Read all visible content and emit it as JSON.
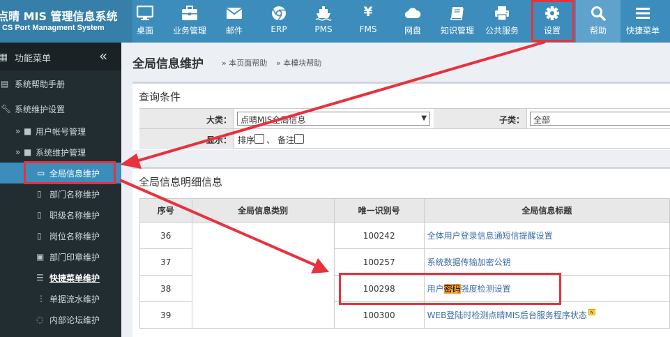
{
  "app": {
    "title": "点晴 MIS 管理信息系统",
    "subtitle": "CS Port Managment System"
  },
  "nav": [
    {
      "label": "桌面",
      "icon": "monitor-icon"
    },
    {
      "label": "业务管理",
      "icon": "briefcase-icon"
    },
    {
      "label": "邮件",
      "icon": "envelope-icon"
    },
    {
      "label": "ERP",
      "icon": "chrome-icon"
    },
    {
      "label": "PMS",
      "icon": "ship-icon"
    },
    {
      "label": "FMS",
      "icon": "yen-icon",
      "glyph": "¥"
    },
    {
      "label": "网盘",
      "icon": "cloud-icon"
    },
    {
      "label": "知识管理",
      "icon": "book-icon"
    },
    {
      "label": "公共服务",
      "icon": "printer-icon"
    },
    {
      "label": "设置",
      "icon": "gear-icon"
    },
    {
      "label": "帮助",
      "icon": "search-icon"
    },
    {
      "label": "快捷菜单",
      "icon": "menu-icon"
    }
  ],
  "sidebar": {
    "header": "功能菜单",
    "collapse_glyph": "«",
    "items": [
      {
        "label": "系统帮助手册",
        "icon": "book-icon"
      },
      {
        "label": "系统维护设置",
        "icon": "wrench-icon"
      },
      {
        "label": "用户帐号管理",
        "icon": "folder-icon",
        "chevron": "»"
      },
      {
        "label": "系统维护管理",
        "icon": "folder-icon",
        "chevron": "»"
      },
      {
        "label": "全局信息维护",
        "icon": "monitor-icon"
      },
      {
        "label": "部门名称维护",
        "icon": "file-icon"
      },
      {
        "label": "职级名称维护",
        "icon": "file-icon"
      },
      {
        "label": "岗位名称维护",
        "icon": "file-icon"
      },
      {
        "label": "部门印章维护",
        "icon": "idcard-icon"
      },
      {
        "label": "快捷菜单维护",
        "icon": "list-icon"
      },
      {
        "label": "单据流水维护",
        "icon": "sliders-icon"
      },
      {
        "label": "内部论坛维护",
        "icon": "comments-icon"
      }
    ]
  },
  "page": {
    "title": "全局信息维护",
    "help_page": "本页面帮助",
    "help_module": "本模块帮助"
  },
  "query": {
    "title": "查询条件",
    "category_label": "大类：",
    "category_value": "点晴MIS全局信息",
    "subcategory_label": "子类：",
    "subcategory_value": "全部",
    "display_label": "显示：",
    "sort_label": "排序",
    "separator": "、",
    "remark_label": "备注"
  },
  "detail": {
    "title": "全局信息明细信息",
    "columns": [
      "序号",
      "全局信息类别",
      "唯一识别号",
      "全局信息标题"
    ],
    "rows": [
      {
        "seq": "36",
        "category": "",
        "id": "100242",
        "title": "全体用户登录信息通短信提醒设置"
      },
      {
        "seq": "37",
        "category": "",
        "id": "100257",
        "title": "系统数据传输加密公钥"
      },
      {
        "seq": "38",
        "category": "",
        "id": "100298",
        "title_pre": "用户",
        "title_hl": "密码",
        "title_post": "强度检测设置"
      },
      {
        "seq": "39",
        "category": "",
        "id": "100300",
        "title": "WEB登陆时检测点晴MIS后台服务程序状态",
        "badge": "N"
      }
    ]
  },
  "colors": {
    "topbar": "#3c8dbc",
    "sidebar": "#222d32",
    "annotation": "#e8313d",
    "highlight": "#f7a13a"
  }
}
